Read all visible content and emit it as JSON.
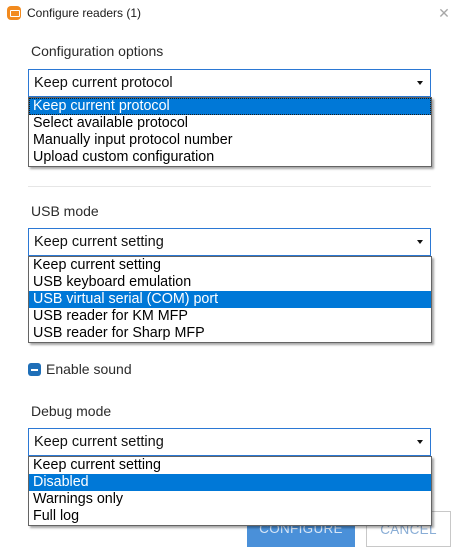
{
  "window": {
    "title": "Configure readers (1)",
    "close_glyph": "✕"
  },
  "configuration": {
    "label": "Configuration options",
    "selected": "Keep current protocol",
    "options": [
      "Keep current protocol",
      "Select available protocol",
      "Manually input protocol number",
      "Upload custom configuration"
    ],
    "highlighted_index": 0
  },
  "usb_mode": {
    "label": "USB mode",
    "selected": "Keep current setting",
    "options": [
      "Keep current setting",
      "USB keyboard emulation",
      "USB virtual serial (COM) port",
      "USB reader for KM MFP",
      "USB reader for Sharp MFP"
    ],
    "highlighted_index": 2
  },
  "sound": {
    "label": "Enable sound",
    "checked": true
  },
  "debug_mode": {
    "label": "Debug mode",
    "selected": "Keep current setting",
    "options": [
      "Keep current setting",
      "Disabled",
      "Warnings only",
      "Full log"
    ],
    "highlighted_index": 1
  },
  "footer": {
    "configure_label": "CONFIGURE",
    "cancel_label": "CANCEL"
  },
  "colors": {
    "accent": "#0078d7",
    "primary_button": "#4a90d9",
    "app_icon": "#f28a1e"
  }
}
